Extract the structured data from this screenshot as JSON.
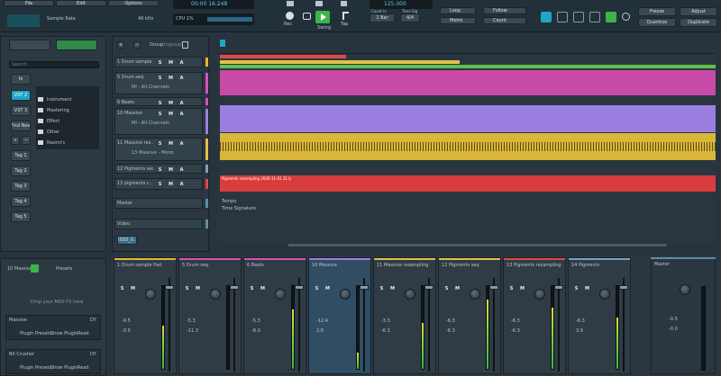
{
  "toolbar": {
    "tab1": "File",
    "tab2": "Edit",
    "tab3": "Options",
    "sample_rate_label": "Sample Rate",
    "sample_rate_value": "48 kHz",
    "time_display": "00:00 16:248",
    "cpu_label": "CPU 1%",
    "logo": "SoundBridge",
    "btn_rec": "Rec",
    "btn_swing": "Swing",
    "btn_tap": "Tap",
    "tempo": "125.000",
    "count_label": "Count In",
    "count_value": "1 Bar",
    "time_sig_label": "Time Sig",
    "time_sig_value": "4/4",
    "loop": "Loop",
    "metro": "Metro",
    "follow": "Follow",
    "count": "Count",
    "freeze": "Freeze",
    "adjust": "Adjust",
    "quantize": "Quantize",
    "duplicate": "Duplicate"
  },
  "browser": {
    "search_placeholder": "Search",
    "nav": [
      "VST 2",
      "VST 3",
      "Find New"
    ],
    "folders": [
      "Instrument",
      "Mastering",
      "Effect",
      "Other",
      "Naomi's"
    ],
    "tags": [
      "Tag 1",
      "Tag 2",
      "Tag 3",
      "Tag 4",
      "Tag 5"
    ]
  },
  "tracks_header": {
    "group": "Group",
    "ungroup": "Ungroup"
  },
  "tracks": [
    {
      "name": "1 Drum sample Pad",
      "color": "#e9b43a"
    },
    {
      "name": "5 Drum seq",
      "sub": "MI - All Channels",
      "color": "#d94fc0"
    },
    {
      "name": "6 Beats",
      "color": "#d94fc0"
    },
    {
      "name": "10 Massive",
      "sub": "MI - All Channels",
      "color": "#9b7fe0"
    },
    {
      "name": "11 Massive res..",
      "sub": "13 Massive - Mono",
      "color": "#e0c24a"
    },
    {
      "name": "12 Pigments seq",
      "color": "#7fa0c0"
    },
    {
      "name": "13 pigments r...",
      "color": "#e04848"
    },
    {
      "name": "Master",
      "color": "#5d8ea8"
    },
    {
      "name": "Video",
      "color": "#5d8ea8"
    }
  ],
  "video_clip": "2020_0...",
  "arrange": {
    "tempo_lane": "Tempo",
    "time_sig_lane": "Time Signature",
    "clip_label": "Pigments resampling 2020-11-01 31 b"
  },
  "fx_panel": {
    "device": "10 Massive",
    "presets": "Presets",
    "drop_hint": "Drop your MIDI FX here",
    "plugin1": "Massive",
    "plugin2": "Bit Crusher",
    "plugin_presets": "Plugin Presets",
    "show_plugin": "Show Plugin",
    "read": "Read",
    "dry": "DY"
  },
  "mixer": [
    {
      "name": "1 Drum sample Pad",
      "color": "#e9b43a",
      "v1": "-9.5",
      "v2": "-3.0",
      "meter": 0.52
    },
    {
      "name": "5 Drum seq",
      "color": "#d94fc0",
      "v1": "-5.3",
      "v2": "-11.3",
      "meter": 0.0
    },
    {
      "name": "6 Beats",
      "color": "#d94fc0",
      "v1": "-5.3",
      "v2": "-8.0",
      "meter": 0.72
    },
    {
      "name": "10 Massive",
      "color": "#9b7fe0",
      "v1": "-12.4",
      "v2": "2.8",
      "meter": 0.2
    },
    {
      "name": "11 Massive resampling",
      "color": "#e0c24a",
      "v1": "-3.3",
      "v2": "-6.3",
      "meter": 0.55
    },
    {
      "name": "12 Pigments seq",
      "color": "#e0c24a",
      "v1": "-6.3",
      "v2": "-6.3",
      "meter": 0.84
    },
    {
      "name": "13 Pigments resampling",
      "color": "#e04848",
      "v1": "-6.3",
      "v2": "-6.3",
      "meter": 0.74
    },
    {
      "name": "14 Pigments",
      "color": "#7fa0c0",
      "v1": "-6.3",
      "v2": "3.9",
      "meter": 0.62
    }
  ],
  "master": {
    "name": "Master",
    "v1": "-0.5",
    "v2": "-0.0",
    "meter": 0.0
  }
}
